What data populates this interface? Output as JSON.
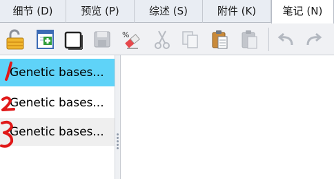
{
  "tabs": [
    {
      "label": "细节 (D)",
      "active": false
    },
    {
      "label": "预览 (P)",
      "active": false
    },
    {
      "label": "综述 (S)",
      "active": false
    },
    {
      "label": "附件 (K)",
      "active": false
    },
    {
      "label": "笔记 (N)",
      "active": true
    }
  ],
  "toolbar": {
    "buttons": [
      {
        "icon": "unlock-icon",
        "enabled": true
      },
      {
        "icon": "add-note-icon",
        "enabled": true
      },
      {
        "icon": "window-icon",
        "enabled": true
      },
      {
        "icon": "save-icon",
        "enabled": false
      },
      {
        "icon": "clear-format-icon",
        "enabled": true
      },
      {
        "icon": "cut-icon",
        "enabled": false
      },
      {
        "icon": "copy-icon",
        "enabled": false
      },
      {
        "icon": "paste-icon",
        "enabled": true
      },
      {
        "icon": "paste-special-icon",
        "enabled": false
      },
      {
        "icon": "undo-icon",
        "enabled": false
      },
      {
        "icon": "redo-icon",
        "enabled": false
      }
    ]
  },
  "notes": [
    {
      "title": "Genetic bases...",
      "selected": true
    },
    {
      "title": "Genetic bases...",
      "selected": false
    },
    {
      "title": "Genetic bases...",
      "selected": false
    }
  ],
  "colors": {
    "selection": "#5fd3f8",
    "annotation": "#e01818"
  }
}
